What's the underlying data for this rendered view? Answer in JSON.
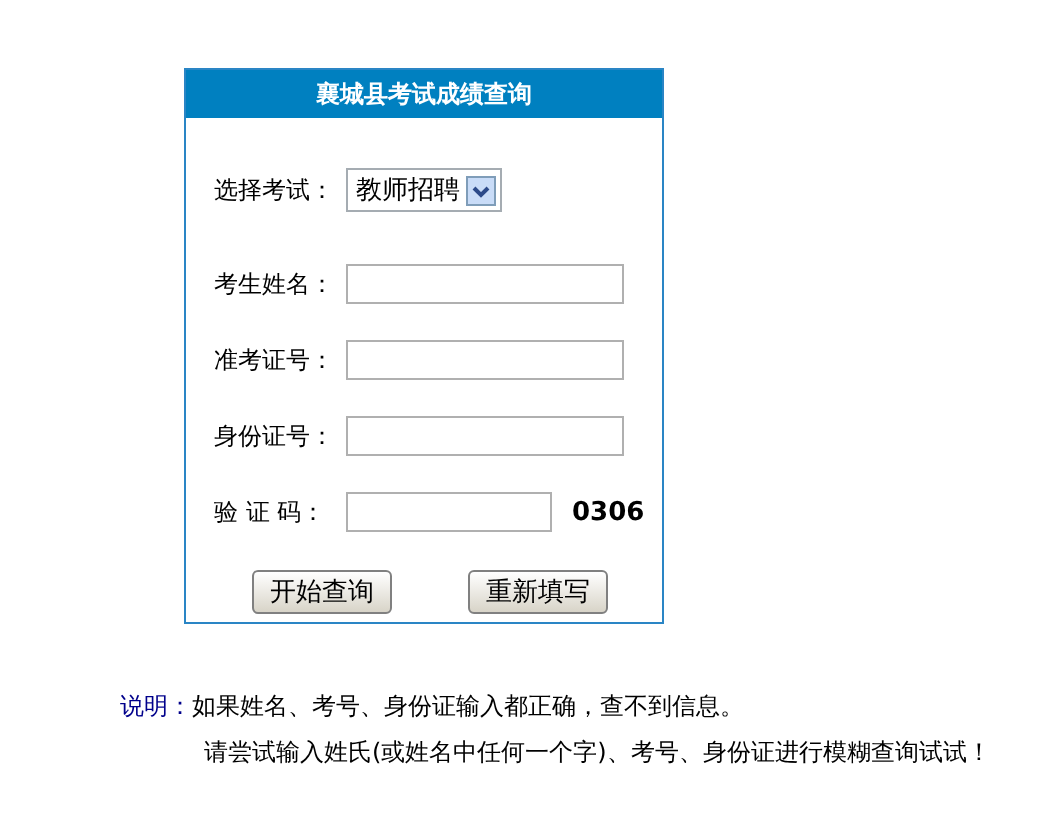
{
  "panel": {
    "title": "襄城县考试成绩查询"
  },
  "fields": [
    {
      "kind": "select",
      "label": "选择考试：",
      "value": "教师招聘"
    },
    {
      "kind": "text",
      "label": "考生姓名："
    },
    {
      "kind": "text",
      "label": "准考证号："
    },
    {
      "kind": "text",
      "label": "身份证号："
    },
    {
      "kind": "captcha",
      "label": "验 证 码：",
      "code": "0306"
    }
  ],
  "buttons": [
    "开始查询",
    "重新填写"
  ],
  "note": {
    "label": "说明：",
    "lines": [
      "如果姓名、考号、身份证输入都正确，查不到信息。",
      "请尝试输入姓氏(或姓名中任何一个字)、考号、身份证进行模糊查询试试！"
    ]
  }
}
